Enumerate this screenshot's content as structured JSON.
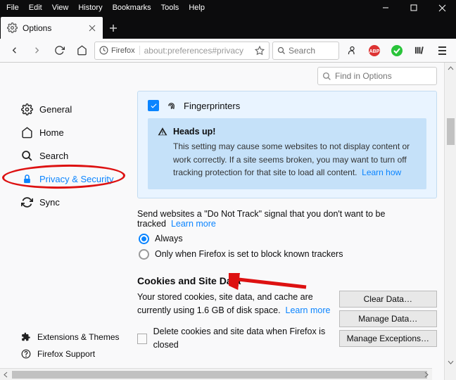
{
  "menubar": [
    "File",
    "Edit",
    "View",
    "History",
    "Bookmarks",
    "Tools",
    "Help"
  ],
  "tab": {
    "title": "Options"
  },
  "url": {
    "identity": "Firefox",
    "text": "about:preferences#privacy"
  },
  "search": {
    "placeholder": "Search"
  },
  "findOptions": {
    "placeholder": "Find in Options"
  },
  "sidebar": {
    "items": [
      {
        "label": "General"
      },
      {
        "label": "Home"
      },
      {
        "label": "Search"
      },
      {
        "label": "Privacy & Security"
      },
      {
        "label": "Sync"
      }
    ],
    "bottom": [
      {
        "label": "Extensions & Themes"
      },
      {
        "label": "Firefox Support"
      }
    ]
  },
  "fingerprinters": {
    "label": "Fingerprinters"
  },
  "warning": {
    "title": "Heads up!",
    "body": "This setting may cause some websites to not display content or work correctly. If a site seems broken, you may want to turn off tracking protection for that site to load all content.",
    "link": "Learn how"
  },
  "dnt": {
    "text": "Send websites a \"Do Not Track\" signal that you don't want to be tracked",
    "link": "Learn more",
    "opt1": "Always",
    "opt2": "Only when Firefox is set to block known trackers"
  },
  "cookies": {
    "title": "Cookies and Site Data",
    "body": "Your stored cookies, site data, and cache are currently using 1.6 GB of disk space.",
    "link": "Learn more",
    "btnClear": "Clear Data…",
    "btnManage": "Manage Data…",
    "btnExceptions": "Manage Exceptions…",
    "deleteLabel": "Delete cookies and site data when Firefox is closed"
  }
}
